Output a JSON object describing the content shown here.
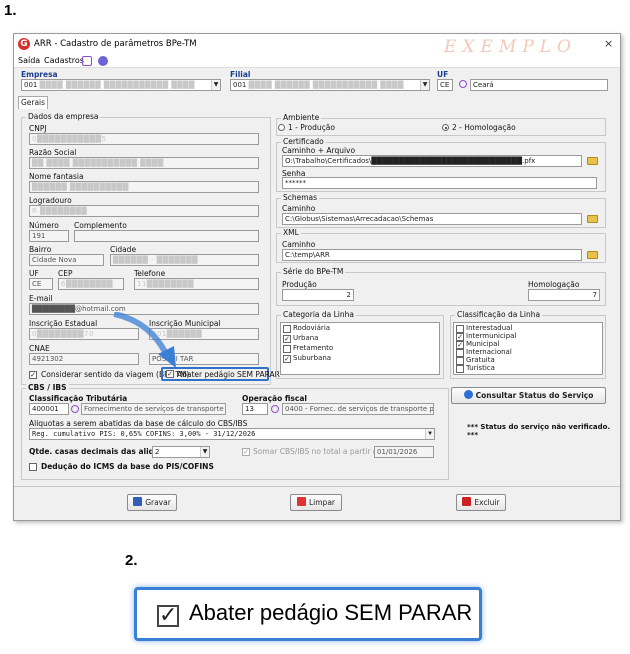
{
  "steps": {
    "one": "1.",
    "two": "2."
  },
  "window": {
    "title": "ARR - Cadastro de parâmetros BPe-TM",
    "watermark": "EXEMPLO",
    "close": "×",
    "app_icon": "G",
    "menu": [
      "Saída",
      "Cadastros"
    ]
  },
  "header": {
    "empresa_label": "Empresa",
    "empresa_value": "001",
    "empresa_name": "████ ██████ ███████████ ████",
    "filial_label": "Filial",
    "filial_value": "001",
    "filial_name": "████ ██████ ███████████ ████",
    "uf_label": "UF",
    "uf_code": "CE",
    "uf_name": "Ceará"
  },
  "tab": "Gerais",
  "dados": {
    "title": "Dados da empresa",
    "cnpj_label": "CNPJ",
    "cnpj_value": "0███████████5",
    "razao_label": "Razão Social",
    "razao_value": "██ ████ ███████████ ████",
    "fantasia_label": "Nome fantasia",
    "fantasia_value": "██████ ██████████",
    "logradouro_label": "Logradouro",
    "logradouro_value": "R ████████",
    "numero_label": "Número",
    "numero_value": "191",
    "complemento_label": "Complemento",
    "complemento_value": "",
    "bairro_label": "Bairro",
    "bairro_value": "Cidade Nova",
    "cidade_label": "Cidade",
    "cidade_value": "██████ - ███████",
    "uf_label": "UF",
    "uf_value": "CE",
    "cep_label": "CEP",
    "cep_value": "6████████",
    "telefone_label": "Telefone",
    "telefone_value": "11████████",
    "email_label": "E-mail",
    "email_value": "████████@hotmail.com",
    "ie_label": "Inscrição Estadual",
    "ie_value": "0████████70",
    "im_label": "Inscrição Municipal",
    "im_value": "401██████",
    "cnae_label": "CNAE",
    "cnae_value": "4921302",
    "extra_value": "POSSUI TAR",
    "considerar_label": "Considerar sentido da viagem (BPe TM)",
    "abater_label": "Abater pedágio SEM PARAR"
  },
  "ambiente": {
    "title": "Ambiente",
    "opt1": "1 - Produção",
    "opt2": "2 - Homologação"
  },
  "certificado": {
    "title": "Certificado",
    "caminho_label": "Caminho + Arquivo",
    "caminho_value": "O:\\Trabalho\\Certificados\\████████████████████████████.pfx",
    "senha_label": "Senha",
    "senha_value": "******"
  },
  "schemas": {
    "title": "Schemas",
    "caminho_label": "Caminho",
    "caminho_value": "C:\\Globus\\Sistemas\\Arrecadacao\\Schemas"
  },
  "xml": {
    "title": "XML",
    "caminho_label": "Caminho",
    "caminho_value": "C:\\temp\\ARR"
  },
  "serie": {
    "title": "Série do BPe-TM",
    "producao_label": "Produção",
    "producao_value": "2",
    "homologacao_label": "Homologação",
    "homologacao_value": "7"
  },
  "categoria": {
    "title": "Categoria da Linha",
    "items": [
      {
        "label": "Rodoviária",
        "checked": false
      },
      {
        "label": "Urbana",
        "checked": true
      },
      {
        "label": "Fretamento",
        "checked": false
      },
      {
        "label": "Suburbana",
        "checked": true
      }
    ]
  },
  "classificacao": {
    "title": "Classificação da Linha",
    "items": [
      {
        "label": "Interestadual",
        "checked": false
      },
      {
        "label": "Intermunicipal",
        "checked": true
      },
      {
        "label": "Municipal",
        "checked": true
      },
      {
        "label": "Internacional",
        "checked": false
      },
      {
        "label": "Gratuita",
        "checked": false
      },
      {
        "label": "Turística",
        "checked": false
      }
    ]
  },
  "cbs": {
    "title": "CBS / IBS",
    "class_label": "Classificação Tributária",
    "class_code": "400001",
    "class_desc": "Fornecimento de serviços de transporte pu",
    "op_label": "Operação fiscal",
    "op_code": "13",
    "op_desc": "0400 - Fornec. de serviços de transporte pu",
    "aliq_label": "Aliquotas a serem abatidas da base de cálculo do CBS/IBS",
    "aliq_value": "Reg. cumulativo PIS: 0,65% COFINS: 3,00% - 31/12/2026",
    "casas_label": "Qtde. casas decimais das aliquotas",
    "casas_value": "2",
    "somar_label": "Somar CBS/IBS no total a partir de:",
    "somar_date": "01/01/2026",
    "deducao_label": "Dedução do ICMS da base do PIS/COFINS"
  },
  "status": {
    "button": "Consultar Status do Serviço",
    "note": "*** Status do serviço não verificado. ***"
  },
  "footer": {
    "gravar": "Gravar",
    "limpar": "Limpar",
    "excluir": "Excluir"
  },
  "zoom": {
    "label": "Abater pedágio SEM PARAR",
    "check": "✓"
  }
}
